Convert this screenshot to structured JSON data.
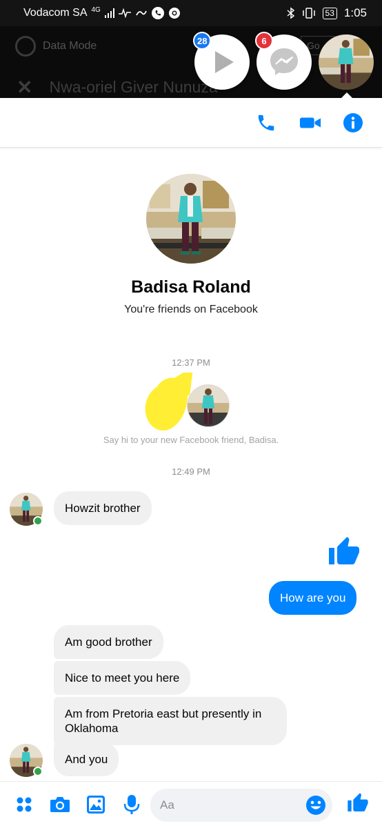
{
  "status_bar": {
    "carrier": "Vodacom SA",
    "network": "4G",
    "battery": "53",
    "time": "1:05"
  },
  "background_app": {
    "data_mode_label": "Data Mode",
    "go_label": "Go",
    "conversation_title": "Nwa-oriel Giver Nunuza"
  },
  "chat_heads": {
    "video_badge": "28",
    "messenger_badge": "6"
  },
  "contact": {
    "name": "Badisa Roland",
    "relationship": "You're friends on Facebook"
  },
  "timeline": {
    "time1": "12:37 PM",
    "say_hi": "Say hi to your new Facebook friend, Badisa.",
    "time2": "12:49 PM"
  },
  "messages": [
    {
      "from": "them",
      "text": "Howzit brother"
    },
    {
      "from": "me",
      "type": "like"
    },
    {
      "from": "me",
      "text": "How are you"
    },
    {
      "from": "them",
      "text": "Am good brother"
    },
    {
      "from": "them",
      "text": "Nice to meet you here"
    },
    {
      "from": "them",
      "text": "Am from Pretoria east but presently in Oklahoma"
    },
    {
      "from": "them",
      "text": "And you"
    }
  ],
  "composer": {
    "placeholder": "Aa",
    "icons": [
      "apps-icon",
      "camera-icon",
      "gallery-icon",
      "microphone-icon",
      "emoji-icon",
      "like-icon"
    ]
  },
  "colors": {
    "accent": "#0084ff",
    "incoming_bubble": "#f0f0f0",
    "online": "#31a24c",
    "badge_red": "#e4323b",
    "badge_blue": "#1877f2",
    "scribble": "#ffee33"
  }
}
